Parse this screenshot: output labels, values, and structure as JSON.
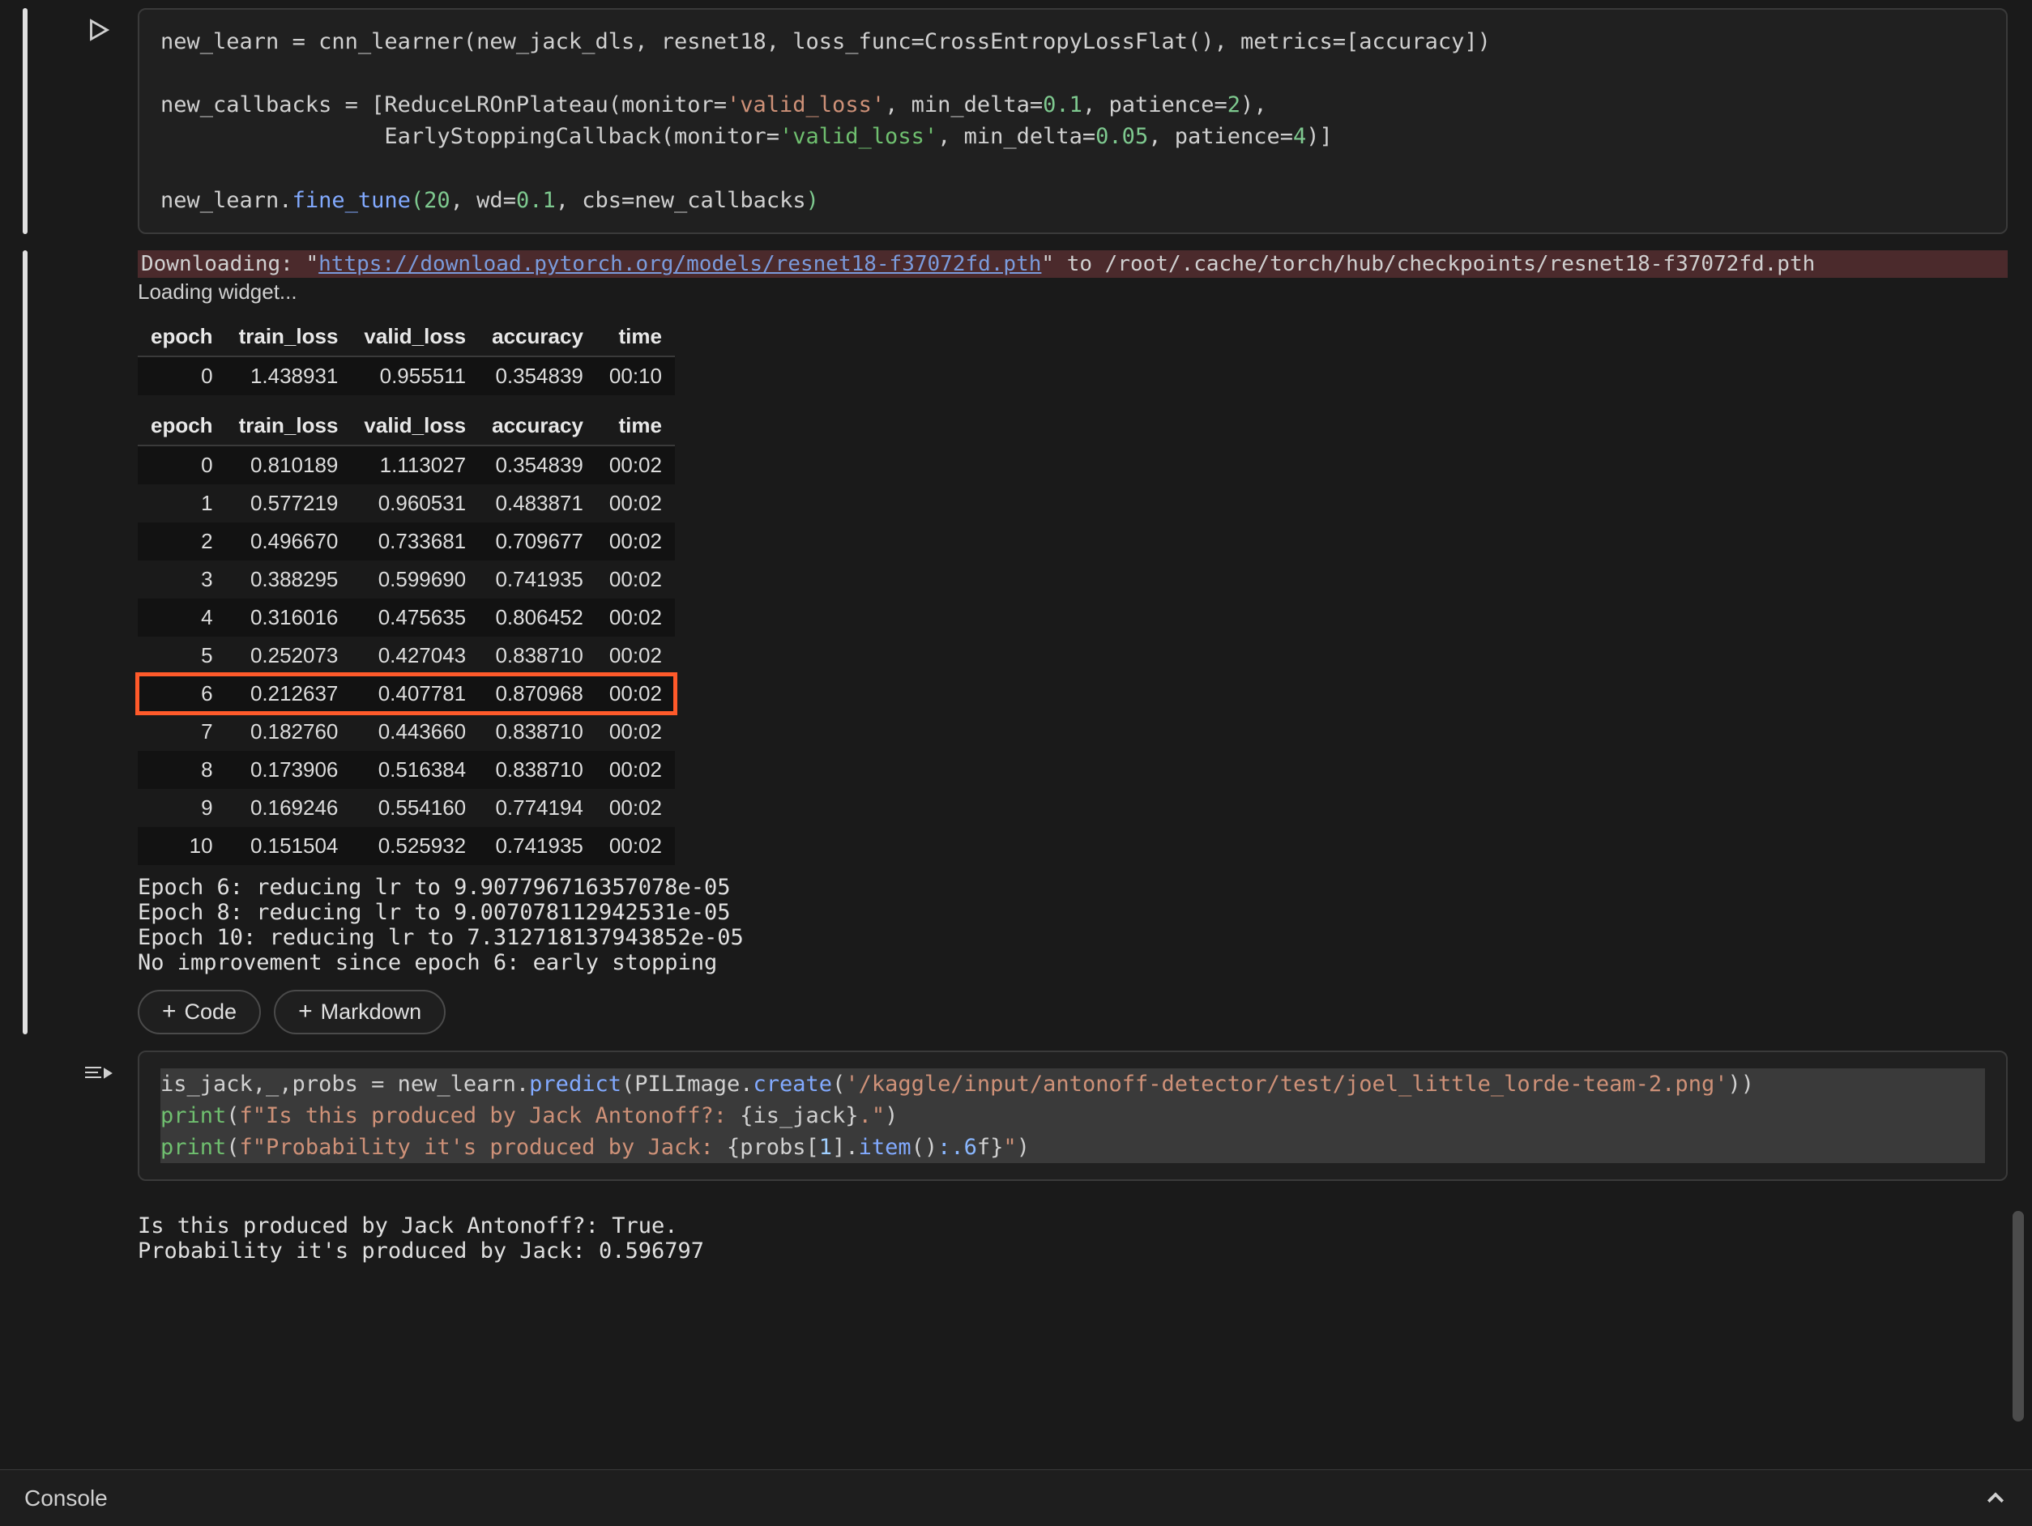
{
  "cell1": {
    "code_tokens": [
      [
        [
          "",
          "new_learn "
        ],
        [
          "tk-op",
          "="
        ],
        [
          "",
          " cnn_learner(new_jack_dls, resnet18, loss_func"
        ],
        [
          "tk-op",
          "="
        ],
        [
          "",
          "CrossEntropyLossFlat(), metrics"
        ],
        [
          "tk-op",
          "="
        ],
        [
          "",
          "[accuracy])"
        ]
      ],
      [],
      [
        [
          "",
          "new_callbacks "
        ],
        [
          "tk-op",
          "="
        ],
        [
          "",
          " [ReduceLROnPlateau(monitor"
        ],
        [
          "tk-op",
          "="
        ],
        [
          "tk-str",
          "'valid_loss'"
        ],
        [
          "",
          ", min_delta"
        ],
        [
          "tk-op",
          "="
        ],
        [
          "tk-num",
          "0.1"
        ],
        [
          "",
          ", patience"
        ],
        [
          "tk-op",
          "="
        ],
        [
          "tk-num",
          "2"
        ],
        [
          "",
          ")"
        ],
        [
          "",
          ","
        ]
      ],
      [
        [
          "",
          "                 EarlyStoppingCallback(monitor"
        ],
        [
          "tk-op",
          "="
        ],
        [
          "tk-strg",
          "'valid_loss'"
        ],
        [
          "",
          ", min_delta"
        ],
        [
          "tk-op",
          "="
        ],
        [
          "tk-num",
          "0.05"
        ],
        [
          "",
          ", patience"
        ],
        [
          "tk-op",
          "="
        ],
        [
          "tk-num",
          "4"
        ],
        [
          "",
          ")]"
        ]
      ],
      [],
      [
        [
          "",
          "new_learn."
        ],
        [
          "tk-fn",
          "fine_tune"
        ],
        [
          "tk-num",
          "("
        ],
        [
          "tk-num",
          "20"
        ],
        [
          "",
          ", wd"
        ],
        [
          "tk-op",
          "="
        ],
        [
          "tk-num",
          "0.1"
        ],
        [
          "",
          ", cbs"
        ],
        [
          "tk-op",
          "="
        ],
        [
          "",
          "new_callbacks"
        ],
        [
          "tk-num",
          ")"
        ]
      ]
    ]
  },
  "download": {
    "prefix": "Downloading: \"",
    "url": "https://download.pytorch.org/models/resnet18-f37072fd.pth",
    "suffix": "\" to /root/.cache/torch/hub/checkpoints/resnet18-f37072fd.pth"
  },
  "loading_text": "Loading widget...",
  "table_headers": [
    "epoch",
    "train_loss",
    "valid_loss",
    "accuracy",
    "time"
  ],
  "table1_rows": [
    [
      "0",
      "1.438931",
      "0.955511",
      "0.354839",
      "00:10"
    ]
  ],
  "table2_rows": [
    [
      "0",
      "0.810189",
      "1.113027",
      "0.354839",
      "00:02"
    ],
    [
      "1",
      "0.577219",
      "0.960531",
      "0.483871",
      "00:02"
    ],
    [
      "2",
      "0.496670",
      "0.733681",
      "0.709677",
      "00:02"
    ],
    [
      "3",
      "0.388295",
      "0.599690",
      "0.741935",
      "00:02"
    ],
    [
      "4",
      "0.316016",
      "0.475635",
      "0.806452",
      "00:02"
    ],
    [
      "5",
      "0.252073",
      "0.427043",
      "0.838710",
      "00:02"
    ],
    [
      "6",
      "0.212637",
      "0.407781",
      "0.870968",
      "00:02"
    ],
    [
      "7",
      "0.182760",
      "0.443660",
      "0.838710",
      "00:02"
    ],
    [
      "8",
      "0.173906",
      "0.516384",
      "0.838710",
      "00:02"
    ],
    [
      "9",
      "0.169246",
      "0.554160",
      "0.774194",
      "00:02"
    ],
    [
      "10",
      "0.151504",
      "0.525932",
      "0.741935",
      "00:02"
    ]
  ],
  "highlight_row_index": 6,
  "messages": "Epoch 6: reducing lr to 9.907796716357078e-05\nEpoch 8: reducing lr to 9.007078112942531e-05\nEpoch 10: reducing lr to 7.312718137943852e-05\nNo improvement since epoch 6: early stopping",
  "buttons": {
    "code": "Code",
    "markdown": "Markdown"
  },
  "cell2": {
    "code_tokens": [
      [
        [
          "",
          "is_jack,_,probs "
        ],
        [
          "tk-op",
          "="
        ],
        [
          "",
          " new_learn."
        ],
        [
          "tk-attr",
          "predict"
        ],
        [
          "",
          "(PILImage."
        ],
        [
          "tk-attr",
          "create"
        ],
        [
          "",
          "("
        ],
        [
          "tk-str",
          "'/kaggle/input/antonoff-detector/test/joel_little_lorde-team-2.png'"
        ],
        [
          "",
          "))"
        ]
      ],
      [
        [
          "tk-builtin",
          "print"
        ],
        [
          "",
          "("
        ],
        [
          "tk-str",
          "f\"Is this produced by Jack Antonoff?: "
        ],
        [
          "",
          "{is_jack}"
        ],
        [
          "tk-str",
          ".\""
        ],
        [
          "",
          ")"
        ]
      ],
      [
        [
          "tk-builtin",
          "print"
        ],
        [
          "",
          "("
        ],
        [
          "tk-str",
          "f\"Probability it's produced by Jack: "
        ],
        [
          "",
          "{probs["
        ],
        [
          "tk-idx",
          "1"
        ],
        [
          "",
          "]."
        ],
        [
          "tk-attr",
          "item"
        ],
        [
          "",
          "()"
        ],
        [
          "tk-fmt",
          ":.6"
        ],
        [
          "",
          "f}"
        ],
        [
          "tk-str",
          "\""
        ],
        [
          "",
          ")"
        ]
      ]
    ]
  },
  "cell2_output": "Is this produced by Jack Antonoff?: True.\nProbability it's produced by Jack: 0.596797",
  "console_label": "Console"
}
